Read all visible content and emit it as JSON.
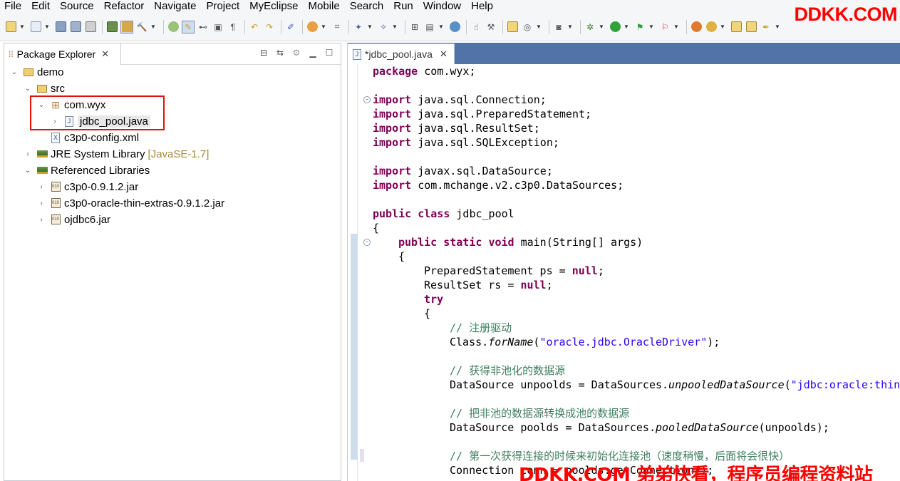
{
  "menu": [
    "File",
    "Edit",
    "Source",
    "Refactor",
    "Navigate",
    "Project",
    "MyEclipse",
    "Mobile",
    "Search",
    "Run",
    "Window",
    "Help"
  ],
  "watermark": {
    "top": "DDKK.COM",
    "bottom": "DDKK.COM 弟弟快看，程序员编程资料站"
  },
  "package_explorer": {
    "tab_title": "Package Explorer",
    "tree": [
      {
        "label": "demo",
        "icon": "project-icon",
        "expanded": true
      },
      {
        "label": "src",
        "icon": "source-folder-icon",
        "expanded": true
      },
      {
        "label": "com.wyx",
        "icon": "package-icon",
        "expanded": true
      },
      {
        "label": "jdbc_pool.java",
        "icon": "java-file-icon",
        "expanded": false,
        "selected": true
      },
      {
        "label": "c3p0-config.xml",
        "icon": "xml-file-icon"
      },
      {
        "label": "JRE System Library",
        "decoration": "[JavaSE-1.7]",
        "icon": "library-icon",
        "expanded": false
      },
      {
        "label": "Referenced Libraries",
        "icon": "library-icon",
        "expanded": true
      },
      {
        "label": "c3p0-0.9.1.2.jar",
        "icon": "jar-icon",
        "expanded": false
      },
      {
        "label": "c3p0-oracle-thin-extras-0.9.1.2.jar",
        "icon": "jar-icon",
        "expanded": false
      },
      {
        "label": "ojdbc6.jar",
        "icon": "jar-icon",
        "expanded": false
      }
    ]
  },
  "editor": {
    "tab_title": "*jdbc_pool.java",
    "lines": {
      "l1a": "package",
      "l1b": " com.wyx;",
      "l3a": "import",
      "l3b": " java.sql.Connection;",
      "l4a": "import",
      "l4b": " java.sql.PreparedStatement;",
      "l5a": "import",
      "l5b": " java.sql.ResultSet;",
      "l6a": "import",
      "l6b": " java.sql.SQLException;",
      "l8a": "import",
      "l8b": " javax.sql.DataSource;",
      "l9a": "import",
      "l9b": " com.mchange.v2.c3p0.DataSources;",
      "l11a": "public",
      "l11b": "class",
      "l11c": " jdbc_pool",
      "l12": "{",
      "l13a": "public",
      "l13b": "static",
      "l13c": "void",
      "l13d": " main(String[] args)",
      "l14": "{",
      "l15a": "PreparedStatement ps = ",
      "l15b": "null",
      "l15c": ";",
      "l16a": "ResultSet rs = ",
      "l16b": "null",
      "l16c": ";",
      "l17": "try",
      "l18": "{",
      "l19": "// 注册驱动",
      "l20a": "Class.",
      "l20b": "forName",
      "l20c": "(",
      "l20d": "\"oracle.jdbc.OracleDriver\"",
      "l20e": ");",
      "l22": "// 获得非池化的数据源",
      "l23a": "DataSource unpoolds = DataSources.",
      "l23b": "unpooledDataSource",
      "l23c": "(",
      "l23d": "\"jdbc:oracle:thin",
      "l25": "// 把非池的数据源转换成池的数据源",
      "l26a": "DataSource poolds = DataSources.",
      "l26b": "pooledDataSource",
      "l26c": "(unpoolds);",
      "l28": "// 第一次获得连接的时候来初始化连接池（速度稍慢，后面将会很快）",
      "l29": "Connection conn = poolds.getConnection();"
    }
  }
}
